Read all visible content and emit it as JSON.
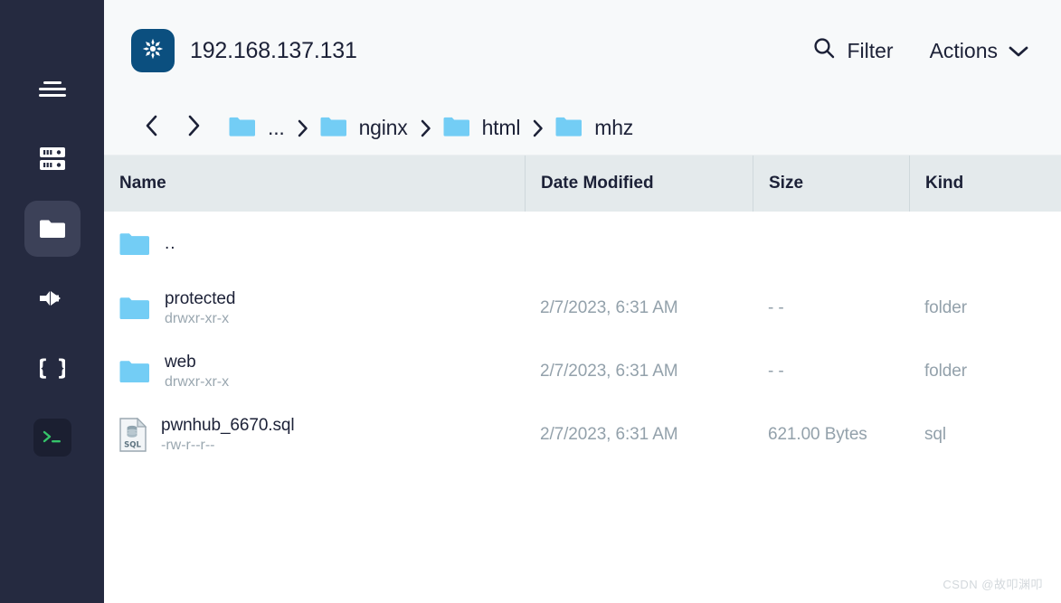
{
  "sidebar": {
    "items": [
      {
        "id": "menu",
        "icon": "hamburger-menu-icon",
        "active": false
      },
      {
        "id": "servers",
        "icon": "server-stack-icon",
        "active": false
      },
      {
        "id": "files",
        "icon": "folder-icon",
        "active": true
      },
      {
        "id": "transfer",
        "icon": "forward-arrow-icon",
        "active": false
      },
      {
        "id": "code",
        "icon": "curly-braces-icon",
        "active": false
      },
      {
        "id": "terminal",
        "icon": "terminal-prompt-icon",
        "active": false
      }
    ]
  },
  "header": {
    "host": "192.168.137.131",
    "logo_icon": "debian-swirl-icon",
    "filter_label": "Filter",
    "filter_icon": "search-icon",
    "actions_label": "Actions",
    "actions_icon": "chevron-down-icon"
  },
  "breadcrumb": {
    "back_icon": "chevron-left-icon",
    "forward_icon": "chevron-right-icon",
    "separator_icon": "chevron-right-icon",
    "items": [
      {
        "label": "...",
        "icon": "folder-icon"
      },
      {
        "label": "nginx",
        "icon": "folder-icon"
      },
      {
        "label": "html",
        "icon": "folder-icon"
      },
      {
        "label": "mhz",
        "icon": "folder-icon"
      }
    ]
  },
  "table": {
    "columns": [
      {
        "key": "name",
        "label": "Name"
      },
      {
        "key": "date",
        "label": "Date Modified"
      },
      {
        "key": "size",
        "label": "Size"
      },
      {
        "key": "kind",
        "label": "Kind"
      }
    ],
    "rows": [
      {
        "name": "..",
        "permissions": "",
        "date": "",
        "size": "",
        "kind": "",
        "icon": "folder-icon"
      },
      {
        "name": "protected",
        "permissions": "drwxr-xr-x",
        "date": "2/7/2023, 6:31 AM",
        "size": "- -",
        "kind": "folder",
        "icon": "folder-icon"
      },
      {
        "name": "web",
        "permissions": "drwxr-xr-x",
        "date": "2/7/2023, 6:31 AM",
        "size": "- -",
        "kind": "folder",
        "icon": "folder-icon"
      },
      {
        "name": "pwnhub_6670.sql",
        "permissions": "-rw-r--r--",
        "date": "2/7/2023, 6:31 AM",
        "size": "621.00 Bytes",
        "kind": "sql",
        "icon": "sql-file-icon"
      }
    ]
  },
  "watermark": "CSDN @故叩渊叩",
  "colors": {
    "sidebar_bg": "#252a40",
    "sidebar_active": "#3c4158",
    "topbar_bg": "#f7f9fa",
    "table_header_bg": "#e4eaec",
    "folder_blue": "#73cdf5",
    "logo_blue": "#0b4f7f",
    "text_dark": "#1c2137",
    "text_muted": "#93a1ab",
    "terminal_green": "#35c46a"
  }
}
